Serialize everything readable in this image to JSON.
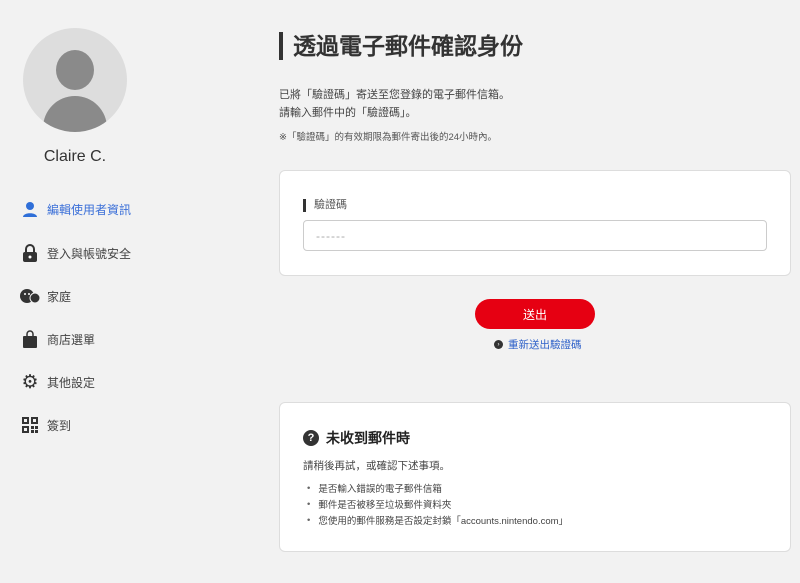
{
  "user": {
    "name": "Claire C."
  },
  "sidebar": {
    "items": [
      {
        "label": "編輯使用者資訊",
        "icon": "user-icon",
        "active": true
      },
      {
        "label": "登入與帳號安全",
        "icon": "lock-icon"
      },
      {
        "label": "家庭",
        "icon": "family-icon"
      },
      {
        "label": "商店選單",
        "icon": "shopping-bag-icon"
      },
      {
        "label": "其他設定",
        "icon": "gear-icon"
      },
      {
        "label": "簽到",
        "icon": "qr-code-icon"
      }
    ]
  },
  "main": {
    "title": "透過電子郵件確認身份",
    "desc1": "已將「驗證碼」寄送至您登錄的電子郵件信箱。",
    "desc2": "請輸入郵件中的「驗證碼」。",
    "note": "※「驗證碼」的有效期限為郵件寄出後的24小時內。",
    "code_label": "驗證碼",
    "code_placeholder": "------",
    "submit_label": "送出",
    "resend_label": "重新送出驗證碼"
  },
  "help": {
    "heading": "未收到郵件時",
    "intro": "請稍後再試，或確認下述事項。",
    "items": [
      "是否輸入錯誤的電子郵件信箱",
      "郵件是否被移至垃圾郵件資料夾",
      "您使用的郵件服務是否設定封鎖「accounts.nintendo.com」"
    ]
  },
  "colors": {
    "accent": "#e60012",
    "link": "#2f62c9"
  }
}
